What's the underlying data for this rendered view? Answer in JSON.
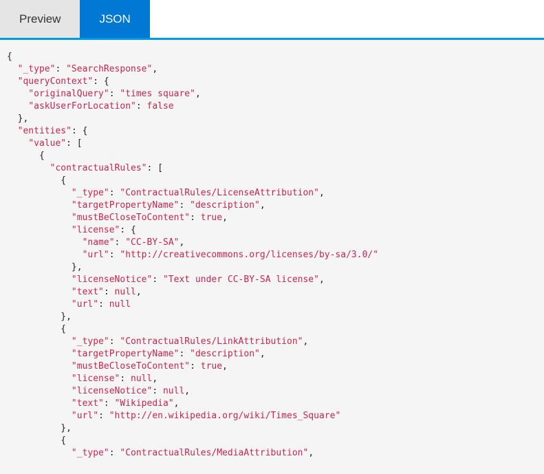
{
  "tabs": {
    "preview": {
      "label": "Preview",
      "active": false
    },
    "json": {
      "label": "JSON",
      "active": true
    }
  },
  "code_lines": [
    [
      [
        "p",
        "{"
      ]
    ],
    [
      [
        "p",
        "  "
      ],
      [
        "k",
        "\"_type\""
      ],
      [
        "p",
        ": "
      ],
      [
        "s",
        "\"SearchResponse\""
      ],
      [
        "p",
        ","
      ]
    ],
    [
      [
        "p",
        "  "
      ],
      [
        "k",
        "\"queryContext\""
      ],
      [
        "p",
        ": {"
      ]
    ],
    [
      [
        "p",
        "    "
      ],
      [
        "k",
        "\"originalQuery\""
      ],
      [
        "p",
        ": "
      ],
      [
        "s",
        "\"times square\""
      ],
      [
        "p",
        ","
      ]
    ],
    [
      [
        "p",
        "    "
      ],
      [
        "k",
        "\"askUserForLocation\""
      ],
      [
        "p",
        ": "
      ],
      [
        "b",
        "false"
      ]
    ],
    [
      [
        "p",
        "  },"
      ]
    ],
    [
      [
        "p",
        "  "
      ],
      [
        "k",
        "\"entities\""
      ],
      [
        "p",
        ": {"
      ]
    ],
    [
      [
        "p",
        "    "
      ],
      [
        "k",
        "\"value\""
      ],
      [
        "p",
        ": ["
      ]
    ],
    [
      [
        "p",
        "      {"
      ]
    ],
    [
      [
        "p",
        "        "
      ],
      [
        "k",
        "\"contractualRules\""
      ],
      [
        "p",
        ": ["
      ]
    ],
    [
      [
        "p",
        "          {"
      ]
    ],
    [
      [
        "p",
        "            "
      ],
      [
        "k",
        "\"_type\""
      ],
      [
        "p",
        ": "
      ],
      [
        "s",
        "\"ContractualRules/LicenseAttribution\""
      ],
      [
        "p",
        ","
      ]
    ],
    [
      [
        "p",
        "            "
      ],
      [
        "k",
        "\"targetPropertyName\""
      ],
      [
        "p",
        ": "
      ],
      [
        "s",
        "\"description\""
      ],
      [
        "p",
        ","
      ]
    ],
    [
      [
        "p",
        "            "
      ],
      [
        "k",
        "\"mustBeCloseToContent\""
      ],
      [
        "p",
        ": "
      ],
      [
        "b",
        "true"
      ],
      [
        "p",
        ","
      ]
    ],
    [
      [
        "p",
        "            "
      ],
      [
        "k",
        "\"license\""
      ],
      [
        "p",
        ": {"
      ]
    ],
    [
      [
        "p",
        "              "
      ],
      [
        "k",
        "\"name\""
      ],
      [
        "p",
        ": "
      ],
      [
        "s",
        "\"CC-BY-SA\""
      ],
      [
        "p",
        ","
      ]
    ],
    [
      [
        "p",
        "              "
      ],
      [
        "k",
        "\"url\""
      ],
      [
        "p",
        ": "
      ],
      [
        "s",
        "\"http://creativecommons.org/licenses/by-sa/3.0/\""
      ]
    ],
    [
      [
        "p",
        "            },"
      ]
    ],
    [
      [
        "p",
        "            "
      ],
      [
        "k",
        "\"licenseNotice\""
      ],
      [
        "p",
        ": "
      ],
      [
        "s",
        "\"Text under CC-BY-SA license\""
      ],
      [
        "p",
        ","
      ]
    ],
    [
      [
        "p",
        "            "
      ],
      [
        "k",
        "\"text\""
      ],
      [
        "p",
        ": "
      ],
      [
        "n",
        "null"
      ],
      [
        "p",
        ","
      ]
    ],
    [
      [
        "p",
        "            "
      ],
      [
        "k",
        "\"url\""
      ],
      [
        "p",
        ": "
      ],
      [
        "n",
        "null"
      ]
    ],
    [
      [
        "p",
        "          },"
      ]
    ],
    [
      [
        "p",
        "          {"
      ]
    ],
    [
      [
        "p",
        "            "
      ],
      [
        "k",
        "\"_type\""
      ],
      [
        "p",
        ": "
      ],
      [
        "s",
        "\"ContractualRules/LinkAttribution\""
      ],
      [
        "p",
        ","
      ]
    ],
    [
      [
        "p",
        "            "
      ],
      [
        "k",
        "\"targetPropertyName\""
      ],
      [
        "p",
        ": "
      ],
      [
        "s",
        "\"description\""
      ],
      [
        "p",
        ","
      ]
    ],
    [
      [
        "p",
        "            "
      ],
      [
        "k",
        "\"mustBeCloseToContent\""
      ],
      [
        "p",
        ": "
      ],
      [
        "b",
        "true"
      ],
      [
        "p",
        ","
      ]
    ],
    [
      [
        "p",
        "            "
      ],
      [
        "k",
        "\"license\""
      ],
      [
        "p",
        ": "
      ],
      [
        "n",
        "null"
      ],
      [
        "p",
        ","
      ]
    ],
    [
      [
        "p",
        "            "
      ],
      [
        "k",
        "\"licenseNotice\""
      ],
      [
        "p",
        ": "
      ],
      [
        "n",
        "null"
      ],
      [
        "p",
        ","
      ]
    ],
    [
      [
        "p",
        "            "
      ],
      [
        "k",
        "\"text\""
      ],
      [
        "p",
        ": "
      ],
      [
        "s",
        "\"Wikipedia\""
      ],
      [
        "p",
        ","
      ]
    ],
    [
      [
        "p",
        "            "
      ],
      [
        "k",
        "\"url\""
      ],
      [
        "p",
        ": "
      ],
      [
        "s",
        "\"http://en.wikipedia.org/wiki/Times_Square\""
      ]
    ],
    [
      [
        "p",
        "          },"
      ]
    ],
    [
      [
        "p",
        "          {"
      ]
    ],
    [
      [
        "p",
        "            "
      ],
      [
        "k",
        "\"_type\""
      ],
      [
        "p",
        ": "
      ],
      [
        "s",
        "\"ContractualRules/MediaAttribution\""
      ],
      [
        "p",
        ","
      ]
    ]
  ]
}
